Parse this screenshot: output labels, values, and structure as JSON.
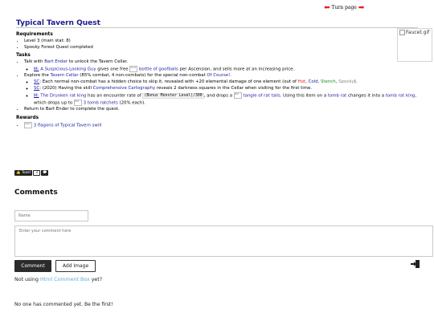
{
  "turn_page": {
    "label": "Turn page"
  },
  "title": "Typical Tavern Quest",
  "faucet_alt": "Faucet.gif",
  "requirements": {
    "heading": "Requirements",
    "items": [
      "Level 3 (main stat: 8)",
      "Spooky Forest Quest completed"
    ]
  },
  "tasks": {
    "heading": "Tasks",
    "t1_pre": "Talk with ",
    "t1_link": "Bart Ender",
    "t1_post": " to unlock the Tavern Cellar.",
    "t1a_tag": "M:",
    "t1a_link1": "A Suspicious-Looking Guy",
    "t1a_mid": " gives one free ",
    "t1a_img": "Goof",
    "t1a_link2": "bottle of goofballs",
    "t1a_post": " per Ascension, and sells more at an increasing price.",
    "t2_pre": "Explore the ",
    "t2_link1": "Tavern Cellar",
    "t2_mid": " (85% combat, 4 non-combats) for the special non-combat ",
    "t2_link2": "Of Course!",
    "t2_post": ".",
    "t2a_tag": "SC",
    "t2a_pre": ": Each normal non-combat has a hidden choice to skip it, revealed with +20 elemental damage of one element (out of ",
    "t2a_hot": "Hot",
    "t2a_cold": "Cold",
    "t2a_stench": "Stench",
    "t2a_spooky": "Spooky",
    "t2a_post": ").",
    "t2b_tag": "SC",
    "t2b_pre": ": (2020) Having the skill ",
    "t2b_link": "Comprehensive Cartography",
    "t2b_post": " reveals 2 darkness squares in the Cellar when visiting for the first time.",
    "t2c_tag": "M:",
    "t2c_link1": "The Drunken rat king",
    "t2c_pre": " has an encounter rate of ",
    "t2c_code": "(Bonus Monster Level)/300",
    "t2c_mid": ", and drops a ",
    "t2c_img1": "Rat",
    "t2c_link2": "tangle of rat tails",
    "t2c_mid2": ". Using this item on a ",
    "t2c_link3": "tomb rat",
    "t2c_mid3": " changes it into a ",
    "t2c_link4": "tomb rat king",
    "t2c_mid4": ", which drops up to ",
    "t2c_img2": "Rat",
    "t2c_link5": "3 tomb ratchets",
    "t2c_post": " (20% each).",
    "t3": "Return to Bart Ender to complete the quest."
  },
  "rewards": {
    "heading": "Rewards",
    "img": "Swill",
    "link": "3 flagons of Typical Tavern swill"
  },
  "toast": {
    "label": "Toast",
    "count": "3"
  },
  "comments": {
    "heading": "Comments",
    "name_placeholder": "Name",
    "comment_placeholder": "Enter your comment here",
    "comment_button": "Comment",
    "add_image_button": "Add Image",
    "not_using_pre": "Not using ",
    "not_using_link": "Html Comment Box",
    "not_using_post": "  yet?",
    "none": "No one has commented yet. Be the first!"
  },
  "colors": {
    "title": "#1a1a8c",
    "link": "#1a1aa6",
    "arrow": "#e0211c",
    "button": "#2b2b2b",
    "hcb_link": "#55aee0"
  },
  "icons": [
    "left-arrow-icon",
    "right-arrow-icon",
    "thumbs-up-icon",
    "comment-bubble-icon",
    "exit-icon"
  ]
}
